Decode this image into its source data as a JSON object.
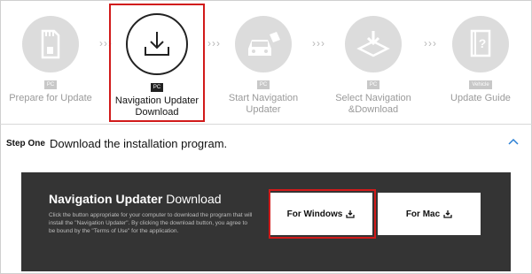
{
  "steps": [
    {
      "label": "Prepare for Update",
      "badge": "PC",
      "icon": "sd-card-icon",
      "active": false
    },
    {
      "label": "Navigation Updater Download",
      "badge": "PC",
      "icon": "download-icon",
      "active": true
    },
    {
      "label": "Start Navigation Updater",
      "badge": "PC",
      "icon": "car-sd-icon",
      "active": false
    },
    {
      "label": "Select Navigation &Download",
      "badge": "PC",
      "icon": "select-download-icon",
      "active": false
    },
    {
      "label": "Update Guide",
      "badge": "Vehicle",
      "icon": "guide-book-icon",
      "active": false
    }
  ],
  "step_row": {
    "step_label": "Step One",
    "title": "Download the installation program."
  },
  "panel": {
    "title_bold": "Navigation Updater",
    "title_rest": " Download",
    "desc": "Click the button appropriate for your computer to download the program that will install the \"Navigation Updater\". By clicking the download button, you agree to be bound by the \"Terms of Use\" for the application.",
    "buttons": {
      "windows": "For Windows",
      "mac": "For Mac"
    }
  },
  "colors": {
    "highlight": "#d11a1a",
    "panel_bg": "#343434",
    "inactive": "#dcdcdc"
  }
}
